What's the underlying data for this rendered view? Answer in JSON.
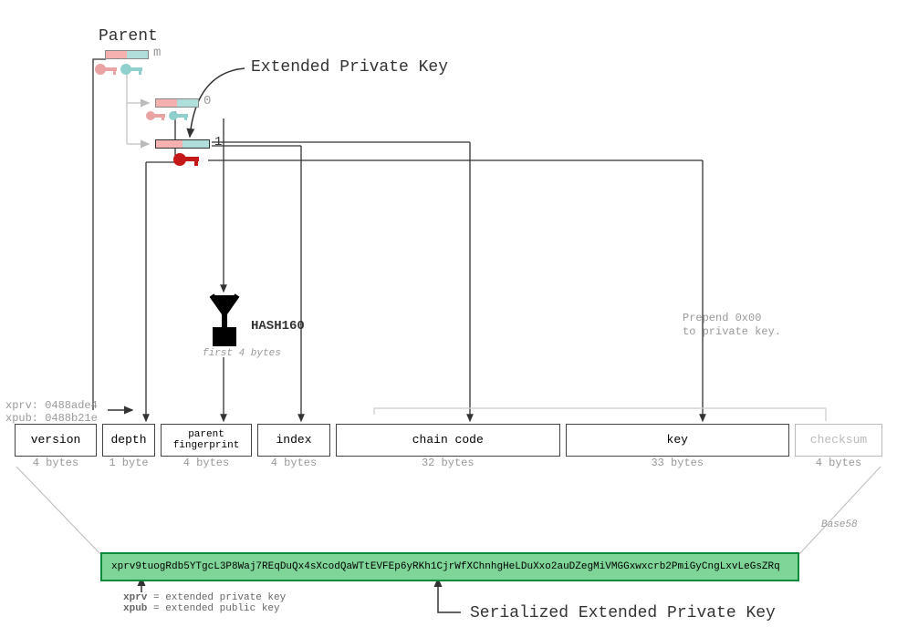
{
  "parent_label": "Parent",
  "extended_priv_label": "Extended Private Key",
  "serialized_label": "Serialized Extended Private Key",
  "hash_label": "HASH160",
  "hash_sub": "first 4 bytes",
  "prepend_note_1": "Prepend 0x00",
  "prepend_note_2": "to private key.",
  "version_prefixes": {
    "xprv": "xprv: 0488ade4",
    "xpub": "xpub: 0488b21e"
  },
  "hierarchy": {
    "m_label": "m",
    "child0_label": "0",
    "child1_label": "1"
  },
  "fields": [
    {
      "name": "version",
      "bytes": "4 bytes"
    },
    {
      "name": "depth",
      "bytes": "1 byte"
    },
    {
      "name": "parent\nfingerprint",
      "bytes": "4 bytes"
    },
    {
      "name": "index",
      "bytes": "4 bytes"
    },
    {
      "name": "chain code",
      "bytes": "32 bytes"
    },
    {
      "name": "key",
      "bytes": "33 bytes"
    },
    {
      "name": "checksum",
      "bytes": "4 bytes"
    }
  ],
  "base58_label": "Base58",
  "serialized_key": "xprv9tuogRdb5YTgcL3P8Waj7REqDuQx4sXcodQaWTtEVFEp6yRKh1CjrWfXChnhgHeLDuXxo2auDZegMiVMGGxwxcrb2PmiGyCngLxvLeGsZRq",
  "legend": {
    "xprv": "xprv",
    "xprv_def": " = extended private key",
    "xpub": "xpub",
    "xpub_def": " = extended public key"
  }
}
